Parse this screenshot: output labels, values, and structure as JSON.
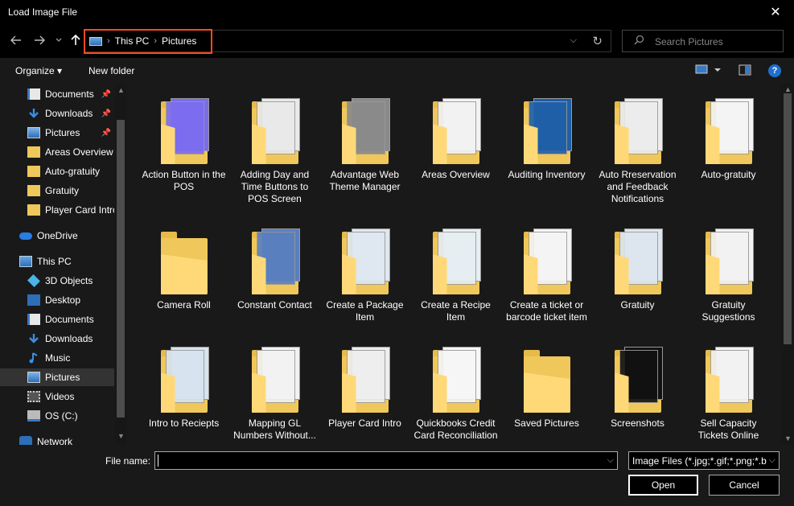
{
  "window": {
    "title": "Load Image File",
    "close_glyph": "✕"
  },
  "nav": {
    "back_icon": "arrow-left-icon",
    "forward_icon": "arrow-right-icon",
    "recent_icon": "chevron-down-icon",
    "up_icon": "arrow-up-icon",
    "breadcrumbs": [
      "This PC",
      "Pictures"
    ],
    "highlight_color": "#ff4a1f",
    "search_placeholder": "Search Pictures"
  },
  "toolbar": {
    "organize": "Organize ▾",
    "new_folder": "New folder",
    "help": "?"
  },
  "sidebar": {
    "items": [
      {
        "label": "Documents",
        "icon": "documents-icon",
        "pinned": true
      },
      {
        "label": "Downloads",
        "icon": "downloads-icon",
        "pinned": true
      },
      {
        "label": "Pictures",
        "icon": "pictures-icon",
        "pinned": true
      },
      {
        "label": "Areas Overview",
        "icon": "folder-icon",
        "pinned": false
      },
      {
        "label": "Auto-gratuity",
        "icon": "folder-icon",
        "pinned": false
      },
      {
        "label": "Gratuity",
        "icon": "folder-icon",
        "pinned": false
      },
      {
        "label": "Player Card Intro",
        "icon": "folder-icon",
        "pinned": false
      },
      {
        "label": "OneDrive",
        "icon": "onedrive-icon",
        "pinned": false
      },
      {
        "label": "This PC",
        "icon": "this-pc-icon",
        "pinned": false
      },
      {
        "label": "3D Objects",
        "icon": "3d-objects-icon",
        "pinned": false
      },
      {
        "label": "Desktop",
        "icon": "desktop-icon",
        "pinned": false
      },
      {
        "label": "Documents",
        "icon": "documents-icon",
        "pinned": false
      },
      {
        "label": "Downloads",
        "icon": "downloads-icon",
        "pinned": false
      },
      {
        "label": "Music",
        "icon": "music-icon",
        "pinned": false
      },
      {
        "label": "Pictures",
        "icon": "pictures-icon",
        "pinned": false,
        "selected": true
      },
      {
        "label": "Videos",
        "icon": "videos-icon",
        "pinned": false
      },
      {
        "label": "OS (C:)",
        "icon": "drive-icon",
        "pinned": false
      },
      {
        "label": "Network",
        "icon": "network-icon",
        "pinned": false
      }
    ]
  },
  "files": [
    {
      "name": "Action Button in the POS",
      "doc": "#7b6cf0"
    },
    {
      "name": "Adding Day and Time Buttons to POS Screen",
      "doc": "#e9e9e9"
    },
    {
      "name": "Advantage Web Theme Manager",
      "doc": "#8a8a8a"
    },
    {
      "name": "Areas Overview",
      "doc": "#f2f2f2"
    },
    {
      "name": "Auditing Inventory",
      "doc": "#1e5fa8"
    },
    {
      "name": "Auto Rreservation and Feedback Notifications",
      "doc": "#ececec"
    },
    {
      "name": "Auto-gratuity",
      "doc": "#f4f4f4"
    },
    {
      "name": "Camera Roll",
      "doc": ""
    },
    {
      "name": "Constant Contact",
      "doc": "#5a7fbf"
    },
    {
      "name": "Create a Package Item",
      "doc": "#dfe8f0"
    },
    {
      "name": "Create a Recipe Item",
      "doc": "#e6eef2"
    },
    {
      "name": "Create a ticket or barcode ticket item",
      "doc": "#f4f4f4"
    },
    {
      "name": "Gratuity",
      "doc": "#dde6ee"
    },
    {
      "name": "Gratuity Suggestions",
      "doc": "#f2f2f2"
    },
    {
      "name": "Intro to Reciepts",
      "doc": "#d7e3ee"
    },
    {
      "name": "Mapping GL Numbers Without...",
      "doc": "#f2f2f2"
    },
    {
      "name": "Player Card Intro",
      "doc": "#eeeeee"
    },
    {
      "name": "Quickbooks Credit Card Reconciliation",
      "doc": "#f6f6f6"
    },
    {
      "name": "Saved Pictures",
      "doc": ""
    },
    {
      "name": "Screenshots",
      "doc": "#111111"
    },
    {
      "name": "Sell Capacity Tickets Online",
      "doc": "#f2f2f2"
    }
  ],
  "footer": {
    "file_name_label": "File name:",
    "file_name_value": "",
    "filter": "Image Files (*.jpg;*.gif;*.png;*.b",
    "open": "Open",
    "cancel": "Cancel"
  }
}
